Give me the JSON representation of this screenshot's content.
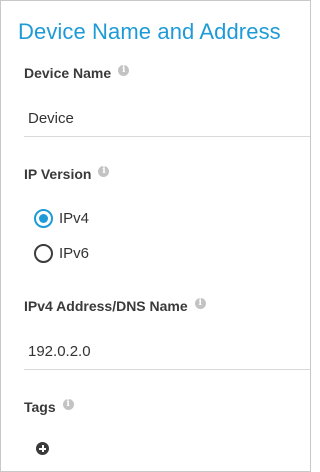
{
  "panel": {
    "title": "Device Name and Address"
  },
  "device_name": {
    "label": "Device Name",
    "value": "Device"
  },
  "ip_version": {
    "label": "IP Version",
    "options": [
      {
        "label": "IPv4",
        "selected": true
      },
      {
        "label": "IPv6",
        "selected": false
      }
    ]
  },
  "address": {
    "label": "IPv4 Address/DNS Name",
    "value": "192.0.2.0"
  },
  "tags": {
    "label": "Tags"
  },
  "icons": {
    "info": "info-icon",
    "add": "plus-circle-icon"
  },
  "colors": {
    "accent": "#1e9bd7",
    "text": "#333333",
    "info_icon": "#c3c3c3"
  }
}
